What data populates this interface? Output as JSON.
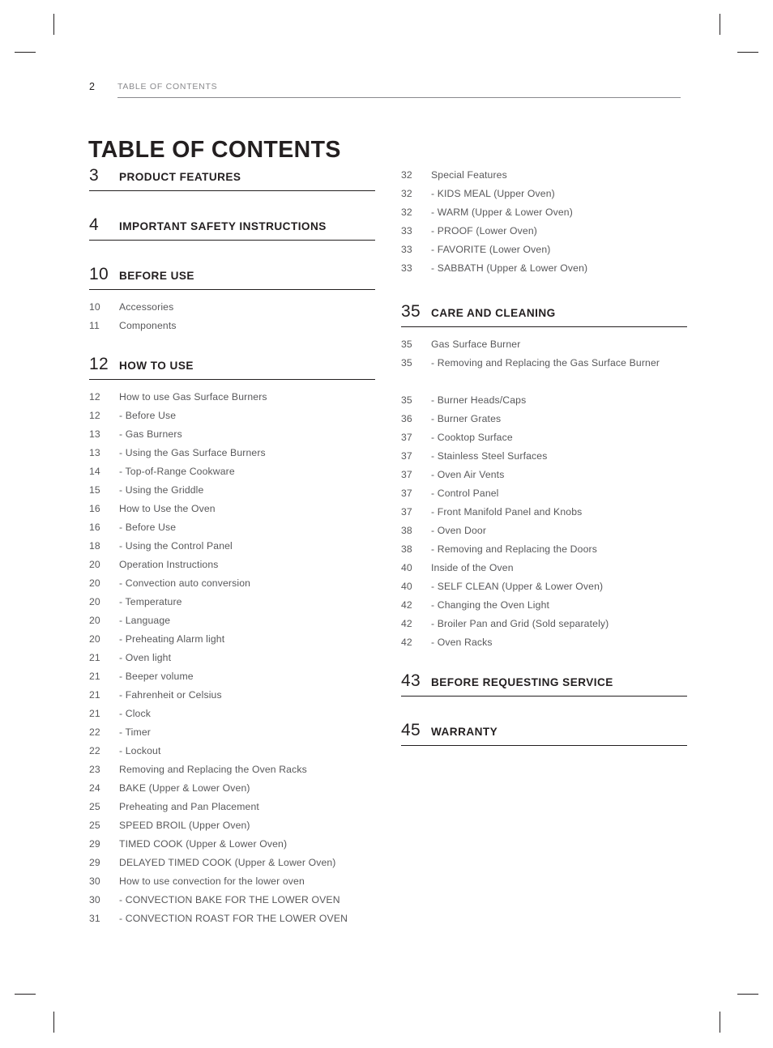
{
  "header": {
    "folio": "2",
    "running_head": "TABLE OF CONTENTS"
  },
  "page_title": "TABLE OF CONTENTS",
  "left_column": {
    "sections": [
      {
        "number": "3",
        "label": "PRODUCT FEATURES",
        "entries": []
      },
      {
        "number": "4",
        "label": "IMPORTANT SAFETY INSTRUCTIONS",
        "entries": []
      },
      {
        "number": "10",
        "label": "BEFORE USE",
        "entries": [
          {
            "page": "10",
            "title": "Accessories"
          },
          {
            "page": "11",
            "title": "Components"
          }
        ]
      },
      {
        "number": "12",
        "label": "HOW TO USE",
        "entries": [
          {
            "page": "12",
            "title": "How to use Gas Surface Burners"
          },
          {
            "page": "12",
            "title": "- Before Use"
          },
          {
            "page": "13",
            "title": "- Gas Burners"
          },
          {
            "page": "13",
            "title": "- Using the Gas Surface Burners"
          },
          {
            "page": "14",
            "title": "- Top-of-Range Cookware"
          },
          {
            "page": "15",
            "title": "- Using the Griddle"
          },
          {
            "page": "16",
            "title": "How to Use the Oven"
          },
          {
            "page": "16",
            "title": "- Before Use"
          },
          {
            "page": "18",
            "title": "- Using the Control Panel"
          },
          {
            "page": "20",
            "title": "Operation Instructions"
          },
          {
            "page": "20",
            "title": "- Convection auto conversion"
          },
          {
            "page": "20",
            "title": "- Temperature"
          },
          {
            "page": "20",
            "title": "- Language"
          },
          {
            "page": "20",
            "title": "- Preheating Alarm light"
          },
          {
            "page": "21",
            "title": "- Oven light"
          },
          {
            "page": "21",
            "title": "- Beeper volume"
          },
          {
            "page": "21",
            "title": "- Fahrenheit or Celsius"
          },
          {
            "page": "21",
            "title": "- Clock"
          },
          {
            "page": "22",
            "title": "- Timer"
          },
          {
            "page": "22",
            "title": "- Lockout"
          },
          {
            "page": "23",
            "title": "Removing and Replacing the Oven Racks"
          },
          {
            "page": "24",
            "title": "BAKE (Upper & Lower Oven)"
          },
          {
            "page": "25",
            "title": "Preheating and Pan Placement"
          },
          {
            "page": "25",
            "title": "SPEED BROIL (Upper Oven)"
          },
          {
            "page": "29",
            "title": "TIMED COOK (Upper & Lower Oven)"
          },
          {
            "page": "29",
            "title": "DELAYED TIMED COOK (Upper & Lower Oven)"
          },
          {
            "page": "30",
            "title": "How to use convection for the lower oven"
          },
          {
            "page": "30",
            "title": "- CONVECTION BAKE FOR THE LOWER OVEN"
          },
          {
            "page": "31",
            "title": "- CONVECTION ROAST FOR THE LOWER OVEN"
          }
        ]
      }
    ]
  },
  "right_column": {
    "orphan_entries": [
      {
        "page": "32",
        "title": "Special Features"
      },
      {
        "page": "32",
        "title": "- KIDS MEAL (Upper Oven)"
      },
      {
        "page": "32",
        "title": "- WARM (Upper & Lower Oven)"
      },
      {
        "page": "33",
        "title": "- PROOF (Lower Oven)"
      },
      {
        "page": "33",
        "title": "- FAVORITE (Lower Oven)"
      },
      {
        "page": "33",
        "title": "- SABBATH (Upper & Lower Oven)"
      }
    ],
    "sections": [
      {
        "number": "35",
        "label": "CARE AND CLEANING",
        "entries": [
          {
            "page": "35",
            "title": "Gas Surface Burner"
          },
          {
            "page": "35",
            "title": "- Removing and Replacing the Gas Surface",
            "continuation": "Burner"
          },
          {
            "page": "35",
            "title": "- Burner Heads/Caps"
          },
          {
            "page": "36",
            "title": "- Burner Grates"
          },
          {
            "page": "37",
            "title": "- Cooktop Surface"
          },
          {
            "page": "37",
            "title": "- Stainless Steel Surfaces"
          },
          {
            "page": "37",
            "title": "- Oven Air Vents"
          },
          {
            "page": "37",
            "title": "- Control Panel"
          },
          {
            "page": "37",
            "title": "- Front Manifold Panel and Knobs"
          },
          {
            "page": "38",
            "title": "- Oven Door"
          },
          {
            "page": "38",
            "title": "- Removing and Replacing the Doors"
          },
          {
            "page": "40",
            "title": "Inside of the Oven"
          },
          {
            "page": "40",
            "title": "- SELF CLEAN (Upper & Lower Oven)"
          },
          {
            "page": "42",
            "title": "- Changing the Oven Light"
          },
          {
            "page": "42",
            "title": "- Broiler Pan and Grid (Sold separately)"
          },
          {
            "page": "42",
            "title": "- Oven Racks"
          }
        ]
      },
      {
        "number": "43",
        "label": "BEFORE REQUESTING SERVICE",
        "entries": []
      },
      {
        "number": "45",
        "label": "WARRANTY",
        "entries": []
      }
    ]
  },
  "colors": {
    "text_dark": "#231f20",
    "text_body": "#58585a",
    "text_muted": "#8a8a8d"
  }
}
